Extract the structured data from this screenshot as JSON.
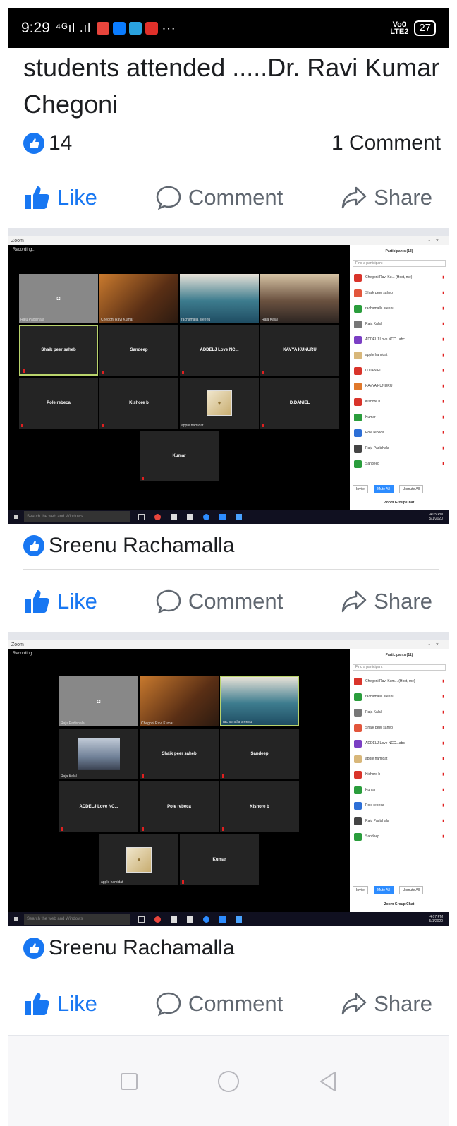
{
  "status_bar": {
    "time": "9:29",
    "signal": "⁴ᴳıl .ıl",
    "volte": "Vo0\nLTE2",
    "battery": "27"
  },
  "post": {
    "text": "students attended .....Dr. Ravi Kumar Chegoni",
    "likes_count": "14",
    "comments_count": "1 Comment"
  },
  "actions": {
    "like": "Like",
    "comment": "Comment",
    "share": "Share"
  },
  "photo1": {
    "recording": "Recording...",
    "tiles": [
      {
        "name": "",
        "caption": "Raju Padishala"
      },
      {
        "name": "",
        "caption": "Chegoni Ravi Kumar"
      },
      {
        "name": "",
        "caption": "rachamalla sreenu"
      },
      {
        "name": "",
        "caption": "Raja Kalal"
      },
      {
        "name": "Shaik peer saheb",
        "caption": ""
      },
      {
        "name": "Sandeep",
        "caption": ""
      },
      {
        "name": "ADDELJ Love NC...",
        "caption": ""
      },
      {
        "name": "KAVYA KUNURU",
        "caption": ""
      },
      {
        "name": "Pole rebeca",
        "caption": ""
      },
      {
        "name": "Kishore b",
        "caption": ""
      },
      {
        "name": "",
        "caption": "apple hamidat"
      },
      {
        "name": "D.DANIEL",
        "caption": ""
      },
      {
        "name": "Kumar",
        "caption": ""
      }
    ],
    "panel_title": "Participants (13)",
    "find": "Find a participant",
    "participants": [
      "Chegoni Ravi Ku... (Host, me)",
      "Shaik peer saheb",
      "rachamalla sreenu",
      "Raja Kalal",
      "ADDELJ Love NCC...abc",
      "apple hamidat",
      "D.DANIEL",
      "KAVYA KUNURU",
      "Kishore b",
      "Kumar",
      "Pole rebeca",
      "Raju Padishala",
      "Sandeep"
    ],
    "btn_invite": "Invite",
    "btn_mute_all": "Mute All",
    "btn_unmute_all": "Unmute All",
    "group_chat": "Zoom Group Chat",
    "taskbar_search": "Search the web and Windows",
    "clock": "4:05 PM\n5/1/2020"
  },
  "photo2": {
    "recording": "Recording...",
    "tiles": [
      {
        "name": "",
        "caption": "Raju Padishala"
      },
      {
        "name": "",
        "caption": "Chegoni Ravi Kumar"
      },
      {
        "name": "",
        "caption": "rachamalla sreenu"
      },
      {
        "name": "",
        "caption": "Raja Kalal"
      },
      {
        "name": "Shaik peer saheb",
        "caption": ""
      },
      {
        "name": "Sandeep",
        "caption": ""
      },
      {
        "name": "ADDELJ Love NC...",
        "caption": ""
      },
      {
        "name": "Pole rebeca",
        "caption": ""
      },
      {
        "name": "Kishore b",
        "caption": ""
      },
      {
        "name": "",
        "caption": "apple hamidat"
      },
      {
        "name": "Kumar",
        "caption": ""
      }
    ],
    "panel_title": "Participants (11)",
    "find": "Find a participant",
    "participants": [
      "Chegoni Ravi Kum... (Host, me)",
      "rachamalla sreenu",
      "Raja Kalal",
      "Shaik peer saheb",
      "ADDELJ Love NCC...abc",
      "apple hamidat",
      "Kishore b",
      "Kumar",
      "Pole rebeca",
      "Raju Padishala",
      "Sandeep"
    ],
    "btn_invite": "Invite",
    "btn_mute_all": "Mute All",
    "btn_unmute_all": "Unmute All",
    "group_chat": "Zoom Group Chat",
    "taskbar_search": "Search the web and Windows",
    "clock": "4:07 PM\n5/1/2020"
  },
  "photo1_author": "Sreenu Rachamalla",
  "photo2_author": "Sreenu Rachamalla"
}
